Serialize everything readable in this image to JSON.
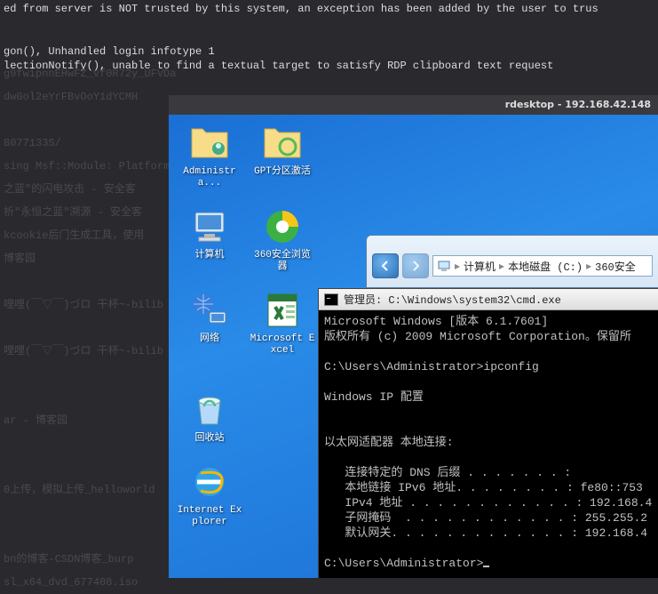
{
  "terminal": {
    "line1": "ed from server is NOT trusted by this system, an exception has been added by the user to trus",
    "line2": "",
    "line3": "gon(), Unhandled login infotype 1",
    "line4": "lectionNotify(), unable to find a textual target to satisfy RDP clipboard text request"
  },
  "ghost": [
    "g9fwipnnEHwFZ_vf0R72y_UFVDa",
    "dwGol2eYrFBvOoY1dYCMH",
    "",
    "8077133S/",
    "sing Msf::Module: Platform",
    "之蓝\"的闪电攻击 - 安全客",
    "析\"永恒之蓝\"溯源 - 安全客",
    "kcookie后门生成工具，使用",
    "博客园",
    "",
    "哩哩(￣▽￣)づロ 干杯~-bilib",
    "",
    "哩哩(￣▽￣)づロ 干杯~-bilib",
    "",
    "",
    "ar - 博客园",
    "",
    "",
    "0上传，模拟上传_helloworld",
    "",
    "",
    "bn的博客-CSDN博客_burp",
    "sl_x64_dvd_677408.iso"
  ],
  "rdesktop_title": "rdesktop - 192.168.42.148",
  "desktop_icons": {
    "admin": "Administra...",
    "gpt": "GPT分区激活",
    "computer": "计算机",
    "browser360": "360安全浏览器",
    "network": "网络",
    "excel": "Microsoft Excel",
    "recycle": "回收站",
    "ie": "Internet Explorer"
  },
  "explorer": {
    "bc1": "计算机",
    "bc2": "本地磁盘 (C:)",
    "bc3": "360安全"
  },
  "cmd": {
    "title": "管理员: C:\\Windows\\system32\\cmd.exe",
    "line1": "Microsoft Windows [版本 6.1.7601]",
    "line2": "版权所有 (c) 2009 Microsoft Corporation。保留所",
    "prompt1": "C:\\Users\\Administrator>ipconfig",
    "ipcfg_title": "Windows IP 配置",
    "adapter": "以太网适配器 本地连接:",
    "dns": "   连接特定的 DNS 后缀 . . . . . . . :",
    "ipv6": "   本地链接 IPv6 地址. . . . . . . . : fe80::753",
    "ipv4": "   IPv4 地址 . . . . . . . . . . . . : 192.168.4",
    "mask": "   子网掩码  . . . . . . . . . . . . : 255.255.2",
    "gw": "   默认网关. . . . . . . . . . . . . : 192.168.4",
    "prompt2": "C:\\Users\\Administrator>"
  }
}
